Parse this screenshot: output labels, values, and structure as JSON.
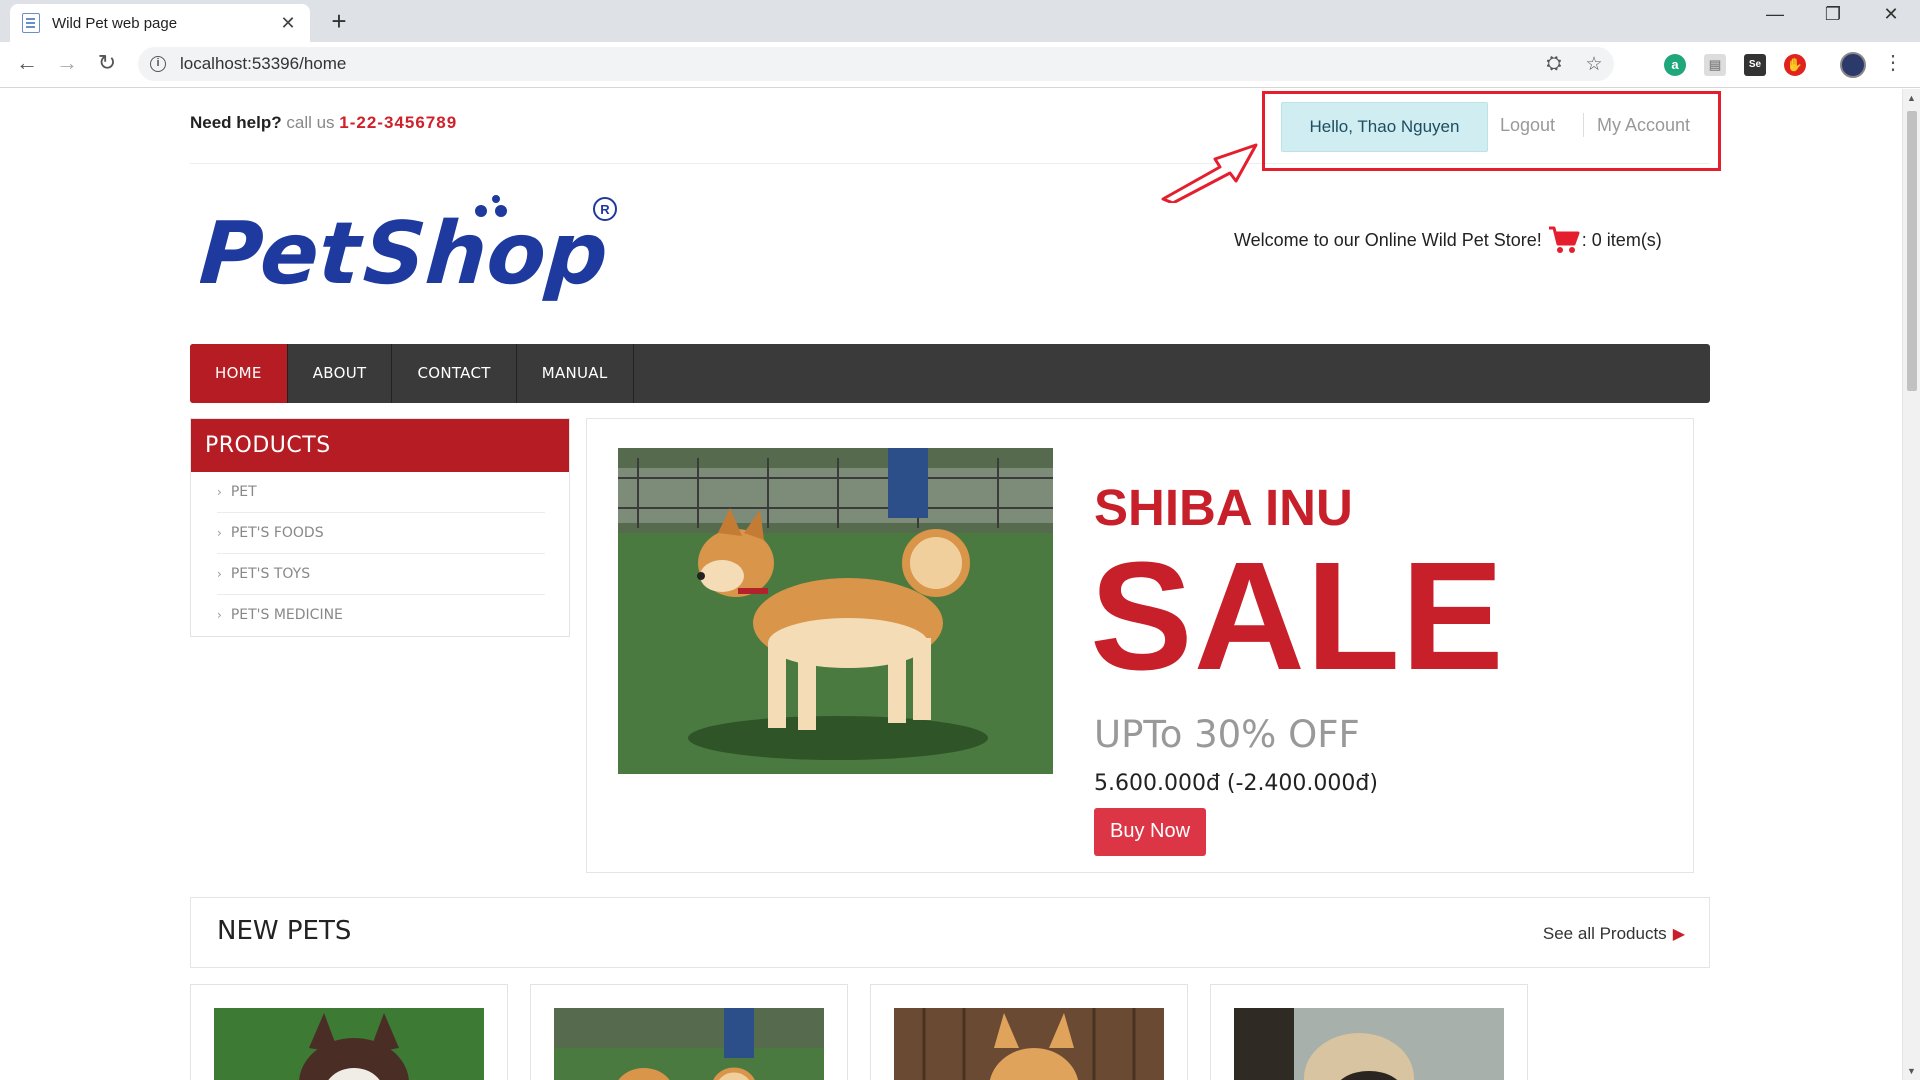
{
  "browser": {
    "tab_title": "Wild Pet web page",
    "url": "localhost:53396/home"
  },
  "top_bar": {
    "help_lead": "Need help?",
    "help_mid": "call us",
    "phone": "1-22-3456789"
  },
  "account": {
    "greeting": "Hello, Thao Nguyen",
    "logout": "Logout",
    "my_account": "My Account"
  },
  "header": {
    "welcome": "Welcome to our Online Wild Pet Store!",
    "cart_count": ": 0 item(s)"
  },
  "nav": {
    "items": [
      "HOME",
      "ABOUT",
      "CONTACT",
      "MANUAL"
    ],
    "active": "HOME"
  },
  "sidebar": {
    "title": "PRODUCTS",
    "items": [
      "PET",
      "PET'S FOODS",
      "PET'S TOYS",
      "PET'S MEDICINE"
    ]
  },
  "promo": {
    "title": "SHIBA INU",
    "sale": "SALE",
    "discount": "UPTo 30% OFF",
    "price": "5.600.000đ (-2.400.000đ)",
    "button": "Buy Now"
  },
  "new_pets": {
    "title": "NEW PETS",
    "see_all": "See all Products"
  },
  "colors": {
    "brand_red": "#b61c24",
    "nav_dark": "#3a3a3a",
    "annotation_red": "#e41e2d",
    "logo_blue": "#1e3a9e"
  }
}
